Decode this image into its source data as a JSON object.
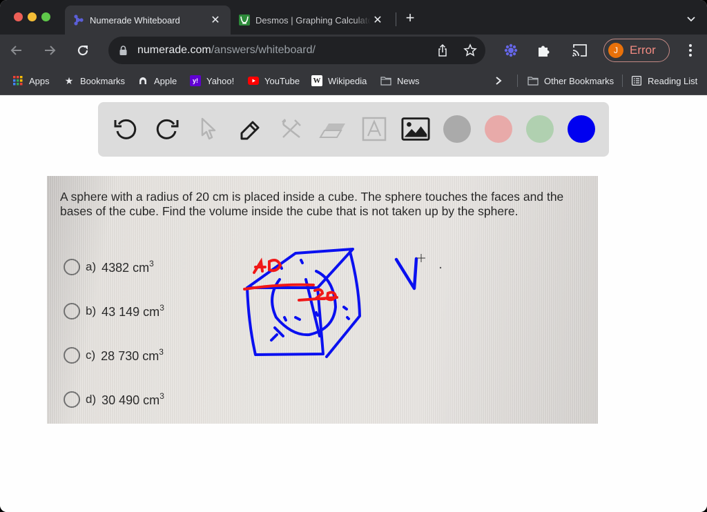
{
  "browser": {
    "tabs": [
      {
        "title": "Numerade Whiteboard",
        "icon": "numerade-icon",
        "active": true
      },
      {
        "title": "Desmos | Graphing Calculator",
        "icon": "desmos-icon",
        "active": false
      }
    ],
    "address_bar": {
      "domain": "numerade.com",
      "path": "/answers/whiteboard/"
    },
    "profile": {
      "initial": "J",
      "label": "Error"
    },
    "bookmarks": [
      {
        "label": "Apps",
        "icon": "apps-grid-icon"
      },
      {
        "label": "Bookmarks",
        "icon": "star-icon"
      },
      {
        "label": "Apple",
        "icon": "apple-icon"
      },
      {
        "label": "Yahoo!",
        "icon": "yahoo-icon"
      },
      {
        "label": "YouTube",
        "icon": "youtube-icon"
      },
      {
        "label": "Wikipedia",
        "icon": "wikipedia-icon"
      },
      {
        "label": "News",
        "icon": "folder-icon"
      }
    ],
    "other_bookmarks": {
      "label": "Other Bookmarks",
      "icon": "folder-icon"
    },
    "reading_list": {
      "label": "Reading List",
      "icon": "reading-list-icon"
    }
  },
  "whiteboard": {
    "tools": [
      {
        "name": "undo",
        "enabled": true
      },
      {
        "name": "redo",
        "enabled": true
      },
      {
        "name": "select",
        "enabled": false
      },
      {
        "name": "pen",
        "enabled": true
      },
      {
        "name": "tools",
        "enabled": false
      },
      {
        "name": "eraser",
        "enabled": false
      },
      {
        "name": "text",
        "enabled": false
      },
      {
        "name": "image",
        "enabled": true
      }
    ],
    "colors": [
      "#aaaaaa",
      "#e8aaa9",
      "#b0d0b0",
      "#0000f0"
    ],
    "selected_color": "#0000f0",
    "annotations": {
      "label_40": "40",
      "label_20": "20",
      "label_v": "V"
    }
  },
  "question": {
    "text": "A sphere with a radius of 20 cm is placed inside a cube. The sphere touches the faces and the bases of the cube. Find the volume inside the cube that is not taken up by the sphere.",
    "options": [
      {
        "letter": "a)",
        "value": "4382 cm",
        "exp": "3"
      },
      {
        "letter": "b)",
        "value": "43 149 cm",
        "exp": "3"
      },
      {
        "letter": "c)",
        "value": "28 730 cm",
        "exp": "3"
      },
      {
        "letter": "d)",
        "value": "30 490 cm",
        "exp": "3"
      }
    ]
  }
}
